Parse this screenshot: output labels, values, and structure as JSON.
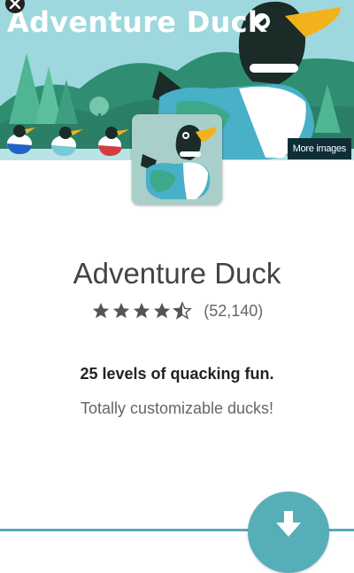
{
  "hero": {
    "title": "Adventure Duck",
    "more_images_label": "More images",
    "sky_color": "#9ed8de"
  },
  "app": {
    "name": "Adventure Duck",
    "rating": 4.5,
    "rating_max": 5,
    "review_count": "(52,140)",
    "tagline": "25 levels of quacking fun.",
    "subline": "Totally customizable ducks!"
  },
  "icons": {
    "close": "close-icon",
    "star": "star-icon",
    "download": "download-icon"
  },
  "colors": {
    "accent": "#56aeb9",
    "star": "#555555"
  }
}
